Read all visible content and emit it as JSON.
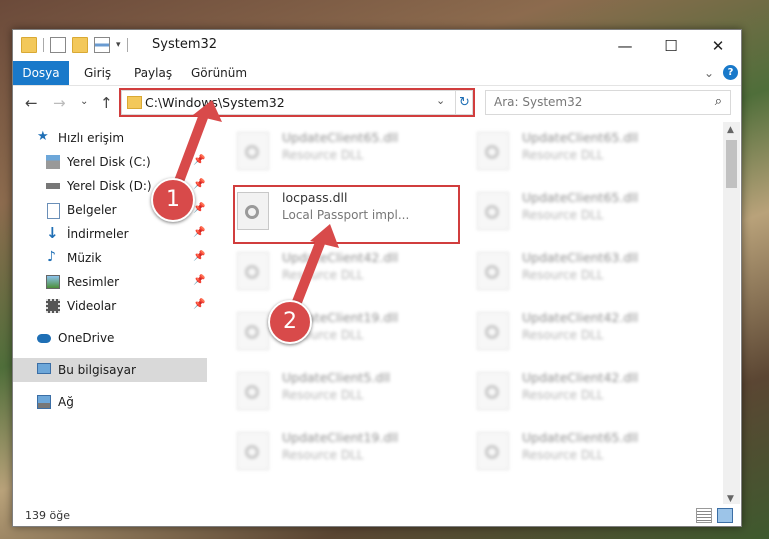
{
  "window": {
    "title": "System32",
    "minimize": "—",
    "maximize": "☐",
    "close": "✕"
  },
  "ribbon": {
    "file": "Dosya",
    "home": "Giriş",
    "share": "Paylaş",
    "view": "Görünüm",
    "help": "?",
    "expand": "⌄"
  },
  "nav": {
    "back": "←",
    "forward": "→",
    "recent": "⌄",
    "up": "↑",
    "refresh": "↻"
  },
  "address": {
    "path": "C:\\Windows\\System32"
  },
  "search": {
    "placeholder": "Ara: System32"
  },
  "sidebar": {
    "quick_access": "Hızlı erişim",
    "items": [
      "Yerel Disk (C:)",
      "Yerel Disk (D:)",
      "Belgeler",
      "İndirmeler",
      "Müzik",
      "Resimler",
      "Videolar"
    ],
    "onedrive": "OneDrive",
    "this_pc": "Bu bilgisayar",
    "network": "Ağ"
  },
  "files": {
    "highlighted": {
      "name": "locpass.dll",
      "desc": "Local Passport impl..."
    },
    "blurred": [
      {
        "name": "UpdateClient65.dll",
        "desc": "Resource DLL"
      },
      {
        "name": "UpdateClient65.dll",
        "desc": "Resource DLL"
      },
      {
        "name": "UpdateClient65.dll",
        "desc": "Resource DLL"
      },
      {
        "name": "UpdateClient42.dll",
        "desc": "Resource DLL"
      },
      {
        "name": "UpdateClient63.dll",
        "desc": "Resource DLL"
      },
      {
        "name": "UpdateClient19.dll",
        "desc": "Resource DLL"
      },
      {
        "name": "UpdateClient42.dll",
        "desc": "Resource DLL"
      },
      {
        "name": "UpdateClient5.dll",
        "desc": "Resource DLL"
      },
      {
        "name": "UpdateClient42.dll",
        "desc": "Resource DLL"
      },
      {
        "name": "UpdateClient19.dll",
        "desc": "Resource DLL"
      },
      {
        "name": "UpdateClient65.dll",
        "desc": "Resource DLL"
      }
    ]
  },
  "status": {
    "count": "139 öğe"
  },
  "annotations": {
    "step1": "1",
    "step2": "2",
    "color": "#d84a4a"
  }
}
